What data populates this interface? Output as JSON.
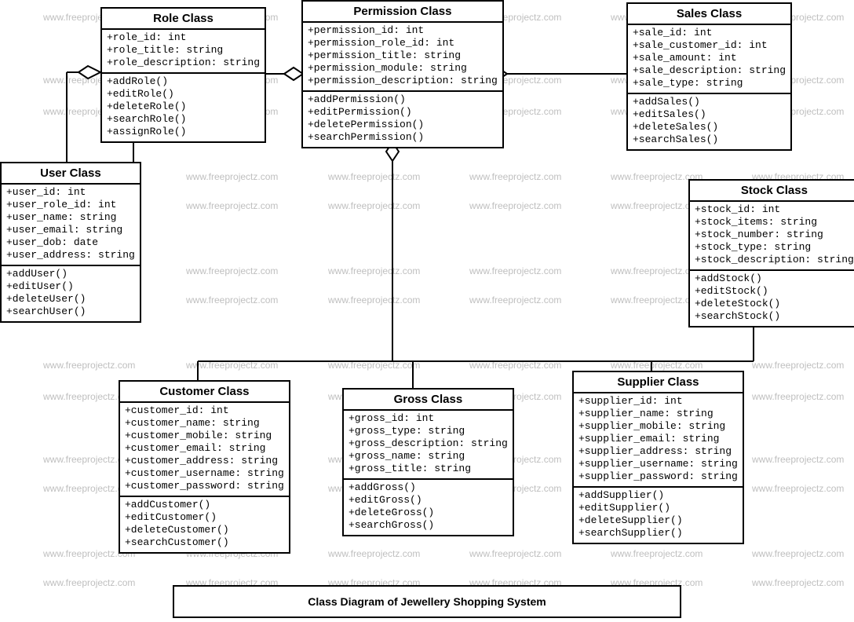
{
  "caption": "Class Diagram of Jewellery Shopping System",
  "watermark": "www.freeprojectz.com",
  "classes": {
    "role": {
      "title": "Role Class",
      "attrs": [
        "+role_id: int",
        "+role_title: string",
        "+role_description: string"
      ],
      "methods": [
        "+addRole()",
        "+editRole()",
        "+deleteRole()",
        "+searchRole()",
        "+assignRole()"
      ]
    },
    "permission": {
      "title": "Permission Class",
      "attrs": [
        "+permission_id: int",
        "+permission_role_id: int",
        "+permission_title: string",
        "+permission_module: string",
        "+permission_description: string"
      ],
      "methods": [
        "+addPermission()",
        "+editPermission()",
        "+deletePermission()",
        "+searchPermission()"
      ]
    },
    "sales": {
      "title": "Sales Class",
      "attrs": [
        "+sale_id: int",
        "+sale_customer_id: int",
        "+sale_amount: int",
        "+sale_description: string",
        "+sale_type: string"
      ],
      "methods": [
        "+addSales()",
        "+editSales()",
        "+deleteSales()",
        "+searchSales()"
      ]
    },
    "user": {
      "title": "User Class",
      "attrs": [
        "+user_id: int",
        "+user_role_id: int",
        "+user_name: string",
        "+user_email: string",
        "+user_dob: date",
        "+user_address: string"
      ],
      "methods": [
        "+addUser()",
        "+editUser()",
        "+deleteUser()",
        "+searchUser()"
      ]
    },
    "stock": {
      "title": "Stock Class",
      "attrs": [
        "+stock_id: int",
        "+stock_items: string",
        "+stock_number: string",
        "+stock_type: string",
        "+stock_description: string"
      ],
      "methods": [
        "+addStock()",
        "+editStock()",
        "+deleteStock()",
        "+searchStock()"
      ]
    },
    "customer": {
      "title": "Customer Class",
      "attrs": [
        "+customer_id: int",
        "+customer_name: string",
        "+customer_mobile: string",
        "+customer_email: string",
        "+customer_address: string",
        "+customer_username: string",
        "+customer_password: string"
      ],
      "methods": [
        "+addCustomer()",
        "+editCustomer()",
        "+deleteCustomer()",
        "+searchCustomer()"
      ]
    },
    "gross": {
      "title": "Gross Class",
      "attrs": [
        "+gross_id: int",
        "+gross_type: string",
        "+gross_description: string",
        "+gross_name: string",
        "+gross_title: string"
      ],
      "methods": [
        "+addGross()",
        "+editGross()",
        "+deleteGross()",
        "+searchGross()"
      ]
    },
    "supplier": {
      "title": "Supplier Class",
      "attrs": [
        "+supplier_id: int",
        "+supplier_name: string",
        "+supplier_mobile: string",
        "+supplier_email: string",
        "+supplier_address: string",
        "+supplier_username: string",
        "+supplier_password: string"
      ],
      "methods": [
        "+addSupplier()",
        "+editSupplier()",
        "+deleteSupplier()",
        "+searchSupplier()"
      ]
    }
  }
}
